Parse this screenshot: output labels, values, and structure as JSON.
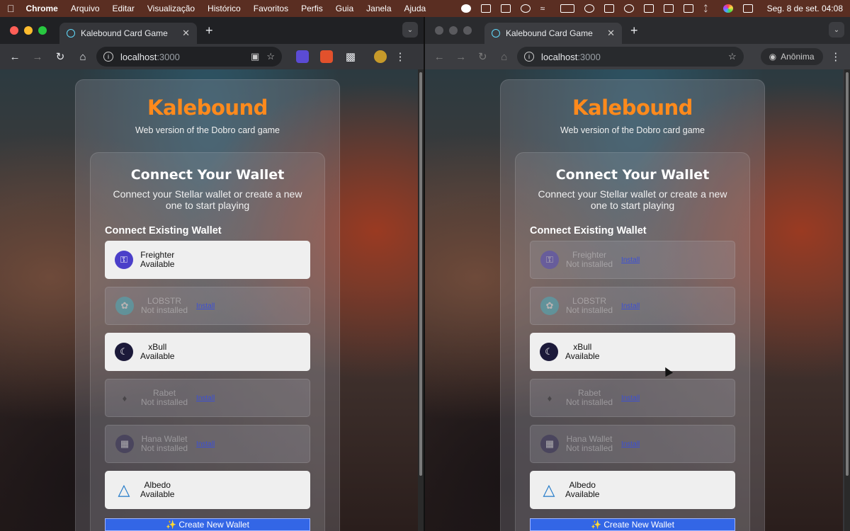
{
  "menubar": {
    "apple": "",
    "items": [
      "Chrome",
      "Arquivo",
      "Editar",
      "Visualização",
      "Histórico",
      "Favoritos",
      "Perfis",
      "Guia",
      "Janela",
      "Ajuda"
    ],
    "clock": "Seg. 8 de set.  04:08"
  },
  "browser_left": {
    "tab_title": "Kalebound Card Game",
    "url_host": "localhost",
    "url_port": ":3000"
  },
  "browser_right": {
    "tab_title": "Kalebound Card Game",
    "url_host": "localhost",
    "url_port": ":3000",
    "incognito_label": "Anônima"
  },
  "app": {
    "brand": "Kalebound",
    "subtitle": "Web version of the Dobro card game",
    "heading": "Connect Your Wallet",
    "description": "Connect your Stellar wallet or create a new one to start playing",
    "section": "Connect Existing Wallet",
    "install_label": "Install",
    "create_label": "✨ Create New Wallet"
  },
  "wallets_left": [
    {
      "name": "Freighter",
      "status": "Available",
      "available": true,
      "icon": "freighter-icon",
      "color": "#4b3fc9"
    },
    {
      "name": "LOBSTR",
      "status": "Not installed",
      "available": false,
      "icon": "lobstr-icon",
      "color": "#3fb8c9"
    },
    {
      "name": "xBull",
      "status": "Available",
      "available": true,
      "icon": "xbull-icon",
      "color": "#1c1a3a"
    },
    {
      "name": "Rabet",
      "status": "Not installed",
      "available": false,
      "icon": "rabet-icon",
      "color": "#222222"
    },
    {
      "name": "Hana Wallet",
      "status": "Not installed",
      "available": false,
      "icon": "hana-icon",
      "color": "#2a2450"
    },
    {
      "name": "Albedo",
      "status": "Available",
      "available": true,
      "icon": "albedo-icon",
      "color": "#1f78c8"
    }
  ],
  "wallets_right": [
    {
      "name": "Freighter",
      "status": "Not installed",
      "available": false,
      "icon": "freighter-icon",
      "color": "#4b3fc9"
    },
    {
      "name": "LOBSTR",
      "status": "Not installed",
      "available": false,
      "icon": "lobstr-icon",
      "color": "#3fb8c9"
    },
    {
      "name": "xBull",
      "status": "Available",
      "available": true,
      "icon": "xbull-icon",
      "color": "#1c1a3a"
    },
    {
      "name": "Rabet",
      "status": "Not installed",
      "available": false,
      "icon": "rabet-icon",
      "color": "#222222"
    },
    {
      "name": "Hana Wallet",
      "status": "Not installed",
      "available": false,
      "icon": "hana-icon",
      "color": "#2a2450"
    },
    {
      "name": "Albedo",
      "status": "Available",
      "available": true,
      "icon": "albedo-icon",
      "color": "#1f78c8"
    }
  ]
}
